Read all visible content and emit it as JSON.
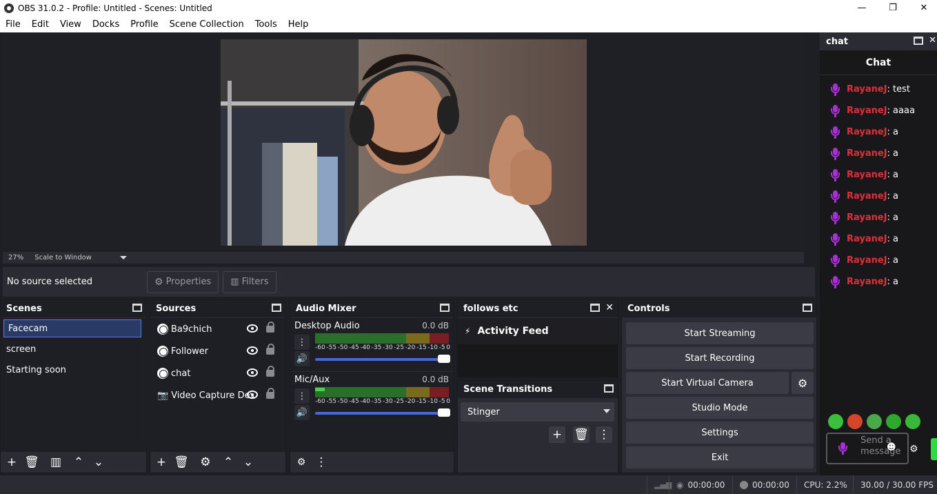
{
  "window": {
    "title": "OBS 31.0.2 - Profile: Untitled - Scenes: Untitled"
  },
  "menu": [
    "File",
    "Edit",
    "View",
    "Docks",
    "Profile",
    "Scene Collection",
    "Tools",
    "Help"
  ],
  "preview": {
    "zoom": "27%",
    "scale_mode": "Scale to Window"
  },
  "context": {
    "no_source": "No source selected",
    "properties_label": "Properties",
    "filters_label": "Filters"
  },
  "scenes": {
    "title": "Scenes",
    "items": [
      "Facecam",
      "screen",
      "Starting soon"
    ]
  },
  "sources": {
    "title": "Sources",
    "items": [
      {
        "name": "Ba9chich",
        "icon": "globe-icon"
      },
      {
        "name": "Follower",
        "icon": "globe-icon"
      },
      {
        "name": "chat",
        "icon": "globe-icon"
      },
      {
        "name": "Video Capture Dev",
        "icon": "camera-icon"
      }
    ]
  },
  "mixer": {
    "title": "Audio Mixer",
    "tracks": [
      {
        "name": "Desktop Audio",
        "db": "0.0 dB",
        "level": 0
      },
      {
        "name": "Mic/Aux",
        "db": "0.0 dB",
        "level": 0.07
      }
    ],
    "scale": [
      "-60",
      "-55",
      "-50",
      "-45",
      "-40",
      "-35",
      "-30",
      "-25",
      "-20",
      "-15",
      "-10",
      "-5",
      "0"
    ]
  },
  "follows": {
    "title": "follows etc",
    "feed_label": "Activity Feed"
  },
  "transitions": {
    "title": "Scene Transitions",
    "selected": "Stinger"
  },
  "controls": {
    "title": "Controls",
    "buttons": [
      "Start Streaming",
      "Start Recording",
      "Start Virtual Camera",
      "Studio Mode",
      "Settings",
      "Exit"
    ]
  },
  "status": {
    "stream_time": "00:00:00",
    "record_time": "00:00:00",
    "cpu": "CPU: 2.2%",
    "fps": "30.00 / 30.00 FPS"
  },
  "chat": {
    "dock_title": "chat",
    "header": "Chat",
    "messages": [
      {
        "user": "RayaneJ",
        "text": ": test"
      },
      {
        "user": "RayaneJ",
        "text": ": aaaa"
      },
      {
        "user": "RayaneJ",
        "text": ": a"
      },
      {
        "user": "RayaneJ",
        "text": ": a"
      },
      {
        "user": "RayaneJ",
        "text": ": a"
      },
      {
        "user": "RayaneJ",
        "text": ": a"
      },
      {
        "user": "RayaneJ",
        "text": ": a"
      },
      {
        "user": "RayaneJ",
        "text": ": a"
      },
      {
        "user": "RayaneJ",
        "text": ": a"
      },
      {
        "user": "RayaneJ",
        "text": ": a"
      }
    ],
    "send_placeholder": "Send a message",
    "user_color": "#e0303a",
    "mic_color": "#a92fd6"
  }
}
